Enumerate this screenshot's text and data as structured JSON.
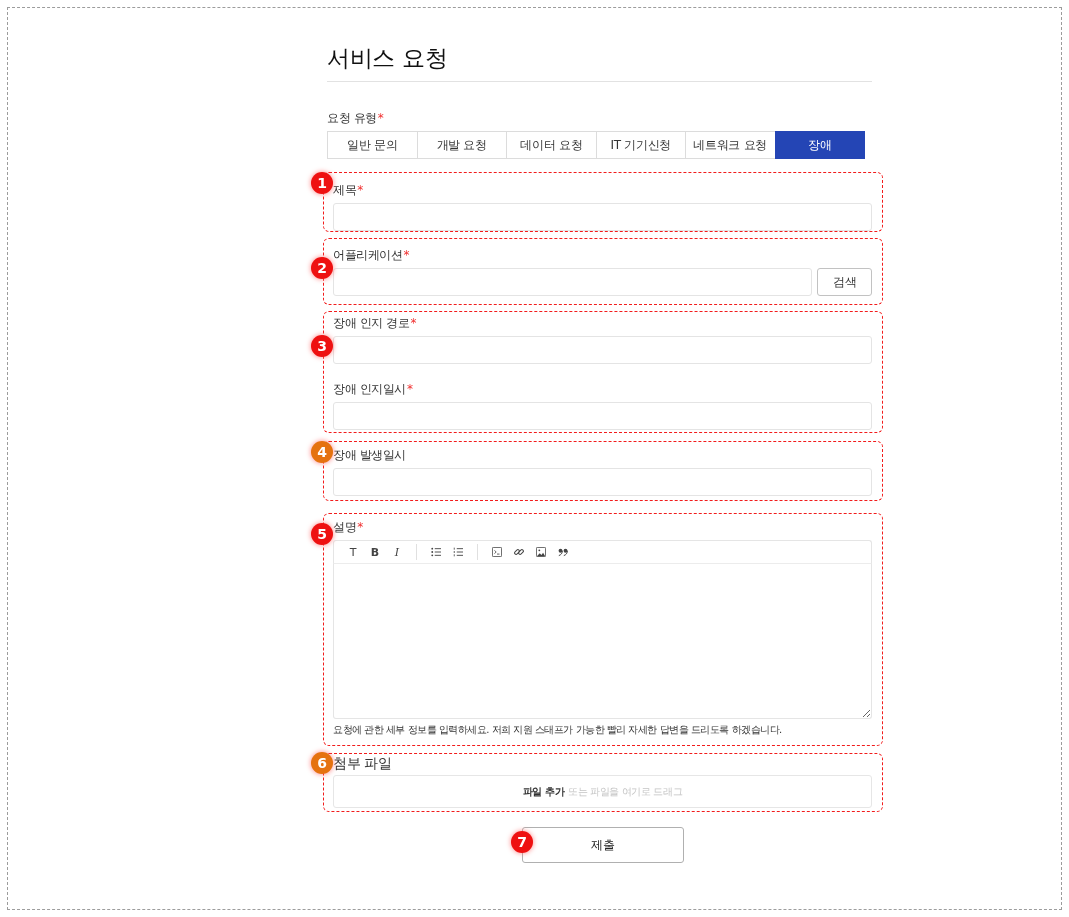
{
  "page": {
    "title": "서비스 요청",
    "required_mark": "*"
  },
  "request_type": {
    "label": "요청 유형",
    "required": true,
    "tabs": [
      {
        "label": "일반 문의",
        "selected": false
      },
      {
        "label": "개발 요청",
        "selected": false
      },
      {
        "label": "데이터 요청",
        "selected": false
      },
      {
        "label": "IT 기기신청",
        "selected": false
      },
      {
        "label": "네트워크 요청",
        "selected": false
      },
      {
        "label": "장애",
        "selected": true
      }
    ]
  },
  "sections": [
    {
      "marker": {
        "number": "1",
        "color": "#ee1111"
      },
      "fields": [
        {
          "kind": "text",
          "label": "제목",
          "required": true
        }
      ]
    },
    {
      "marker": {
        "number": "2",
        "color": "#ee1111"
      },
      "fields": [
        {
          "kind": "search",
          "label": "어플리케이션",
          "required": true,
          "button": "검색"
        }
      ]
    },
    {
      "marker": {
        "number": "3",
        "color": "#ee1111"
      },
      "fields": [
        {
          "kind": "text",
          "label": "장애 인지 경로",
          "required": true
        },
        {
          "kind": "text",
          "label": "장애 인지일시",
          "required": true
        }
      ]
    },
    {
      "marker": {
        "number": "4",
        "color": "#e5720f"
      },
      "fields": [
        {
          "kind": "text",
          "label": "장애 발생일시",
          "required": false
        }
      ]
    },
    {
      "marker": {
        "number": "5",
        "color": "#ee1111"
      },
      "fields": [
        {
          "kind": "editor",
          "label": "설명",
          "required": true,
          "format_buttons": [
            {
              "label": "T",
              "kind": "plain"
            },
            {
              "label": "B",
              "kind": "bold"
            },
            {
              "label": "I",
              "kind": "italic"
            }
          ],
          "help_text": "요청에 관한 세부 정보를 입력하세요. 저희 지원 스태프가 가능한 빨리 자세한 답변을 드리도록 하겠습니다."
        }
      ]
    },
    {
      "marker": {
        "number": "6",
        "color": "#e5720f"
      },
      "fields": [
        {
          "kind": "file",
          "label": "첨부 파일",
          "required": false,
          "action": "파일 추가",
          "hint": "또는 파일을 여기로 드래그"
        }
      ]
    }
  ],
  "submit": {
    "label": "제출",
    "marker": {
      "number": "7",
      "color": "#ee1111"
    }
  }
}
